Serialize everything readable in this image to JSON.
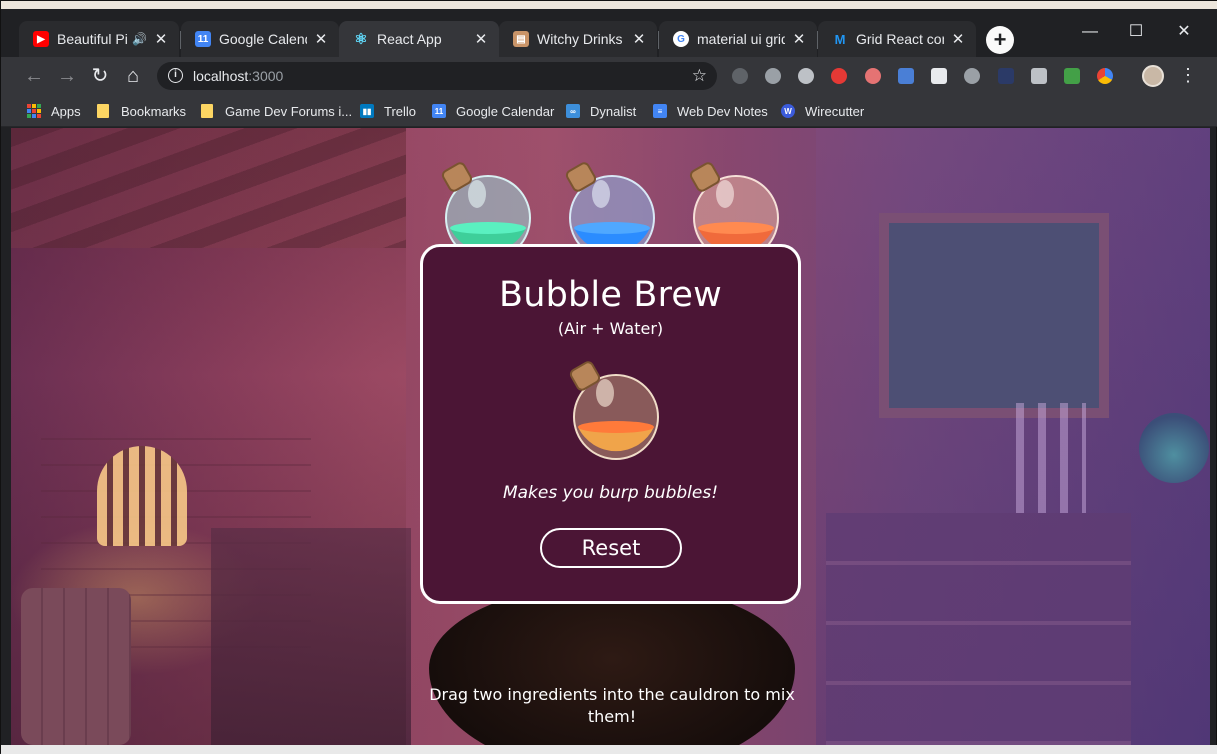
{
  "browser": {
    "tabs": [
      {
        "title": "Beautiful Pia",
        "favicon": "youtube-icon",
        "color": "#ff0000",
        "audio": true
      },
      {
        "title": "Google Calendar",
        "favicon": "google-calendar-icon",
        "color": "#4285f4"
      },
      {
        "title": "React App",
        "favicon": "react-icon",
        "color": "#61dafb",
        "active": true
      },
      {
        "title": "Witchy Drinks | T",
        "favicon": "notebook-icon",
        "color": "#c99468"
      },
      {
        "title": "material ui grid -",
        "favicon": "google-icon",
        "color": "#4285f4"
      },
      {
        "title": "Grid React comp",
        "favicon": "material-ui-icon",
        "color": "#2196f3"
      }
    ],
    "address": {
      "host": "localhost",
      "port": ":3000"
    },
    "bookmarks": [
      {
        "label": "Apps",
        "icon": "apps-grid-icon"
      },
      {
        "label": "Bookmarks",
        "icon": "folder-icon"
      },
      {
        "label": "Game Dev Forums i...",
        "icon": "folder-icon"
      },
      {
        "label": "Trello",
        "icon": "trello-icon",
        "color": "#0079bf"
      },
      {
        "label": "Google Calendar",
        "icon": "google-calendar-icon",
        "color": "#4285f4"
      },
      {
        "label": "Dynalist",
        "icon": "dynalist-icon",
        "color": "#3d8fdb"
      },
      {
        "label": "Web Dev Notes",
        "icon": "docs-icon",
        "color": "#4285f4"
      },
      {
        "label": "Wirecutter",
        "icon": "wirecutter-icon",
        "color": "#3b5bdb"
      }
    ]
  },
  "potions": [
    {
      "name": "green-potion",
      "liquid": "#3ecf9a"
    },
    {
      "name": "blue-potion",
      "liquid": "#2b8cff"
    },
    {
      "name": "orange-potion",
      "liquid": "#f06a3b"
    }
  ],
  "result": {
    "title": "Bubble Brew",
    "subtitle": "(Air + Water)",
    "description": "Makes you burp bubbles!",
    "reset_label": "Reset",
    "liquid": "#f0a44a"
  },
  "cauldron": {
    "hint": "Drag two ingredients into the cauldron to mix them!"
  }
}
